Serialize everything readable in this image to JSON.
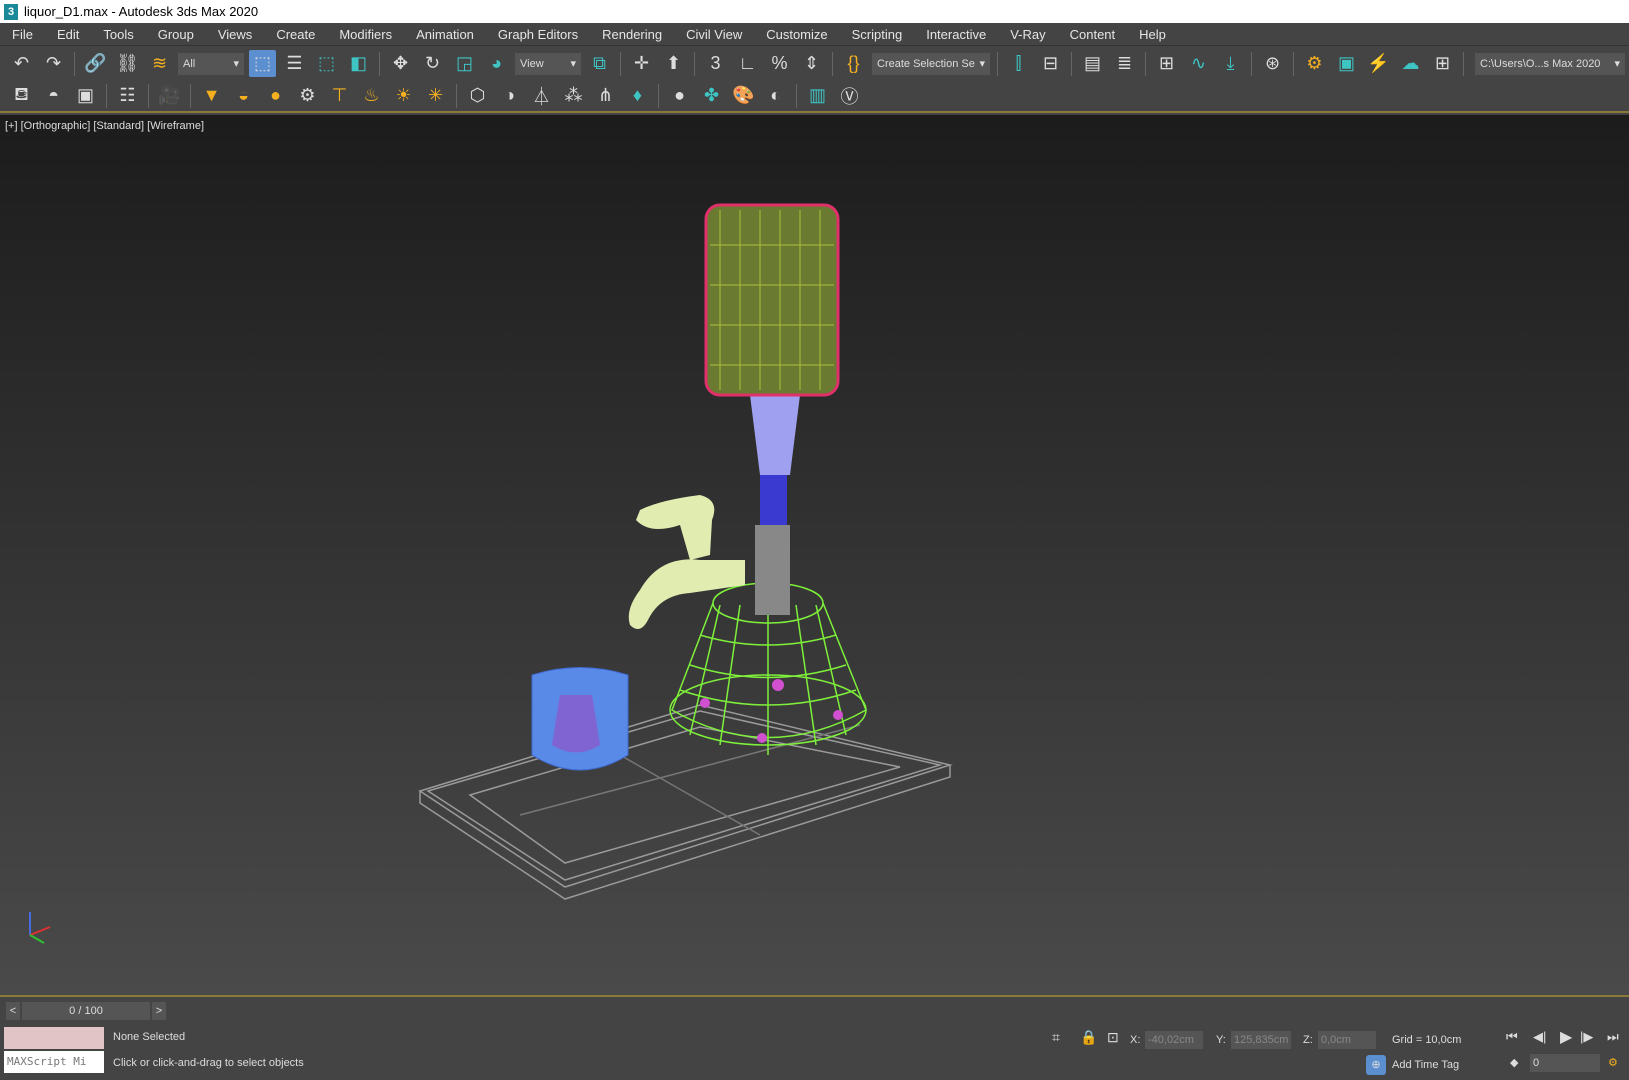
{
  "window": {
    "title": "liquor_D1.max - Autodesk 3ds Max 2020",
    "logo": "3"
  },
  "menu": [
    "File",
    "Edit",
    "Tools",
    "Group",
    "Views",
    "Create",
    "Modifiers",
    "Animation",
    "Graph Editors",
    "Rendering",
    "Civil View",
    "Customize",
    "Scripting",
    "Interactive",
    "V-Ray",
    "Content",
    "Help"
  ],
  "toolbar": {
    "filter": "All",
    "ref_coord": "View",
    "selection_set": "Create Selection Se",
    "project_path": "C:\\Users\\O...s Max 2020"
  },
  "viewport": {
    "label": "[+] [Orthographic] [Standard] [Wireframe]"
  },
  "timeline": {
    "frame": "0 / 100",
    "prev": "<",
    "next": ">"
  },
  "status": {
    "selection": "None Selected",
    "prompt": "Click or click-and-drag to select objects",
    "maxscript": "MAXScript Mi",
    "x_label": "X:",
    "x": "-40,02cm",
    "y_label": "Y:",
    "y": "125,835cm",
    "z_label": "Z:",
    "z": "0,0cm",
    "grid": "Grid = 10,0cm",
    "add_time_tag": "Add Time Tag",
    "current_frame": "0"
  }
}
